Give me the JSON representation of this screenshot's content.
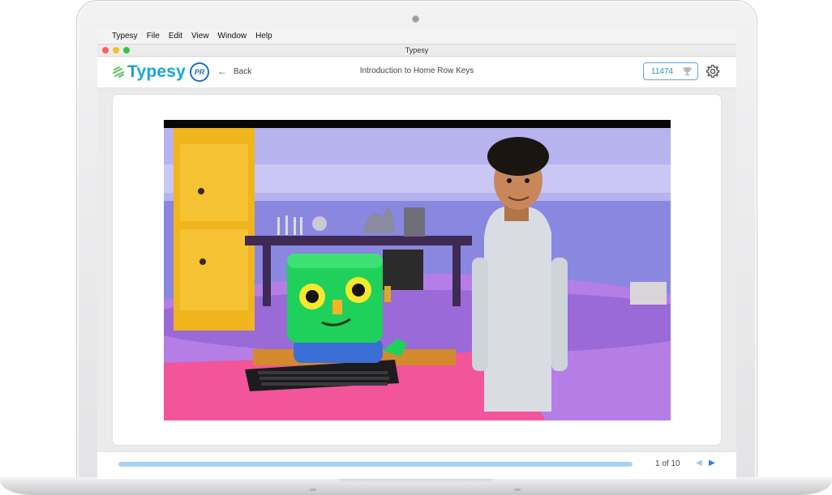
{
  "menubar": {
    "apple_icon": "",
    "items": [
      "Typesy",
      "File",
      "Edit",
      "View",
      "Window",
      "Help"
    ]
  },
  "window": {
    "title": "Typesy"
  },
  "header": {
    "logo_text": "Typesy",
    "badge_text": "PR",
    "back_label": "Back",
    "lesson_title": "Introduction to Home Row Keys",
    "score": "11474"
  },
  "video": {
    "icon": "video-frame"
  },
  "footer": {
    "progress_fraction": 1.0,
    "page_indicator": "1 of 10",
    "prev_icon": "◀",
    "next_icon": "▶"
  },
  "colors": {
    "accent": "#19a6d8",
    "progress": "#a7d3f3",
    "nav_active": "#2a7fd6"
  }
}
